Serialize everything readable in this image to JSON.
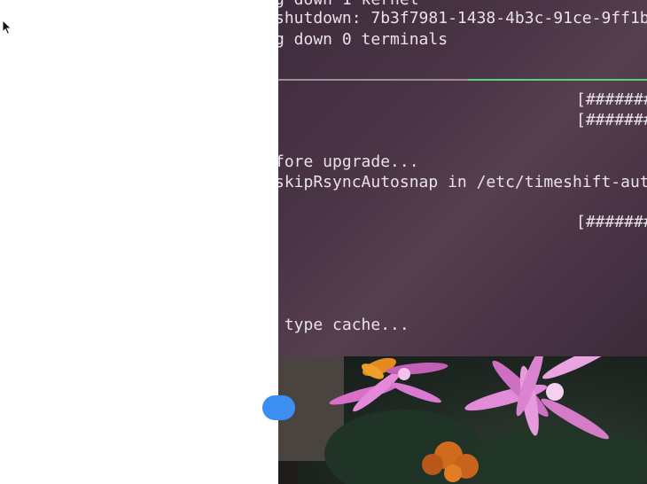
{
  "terminal": {
    "lines": {
      "l1": "g down 1 kernel",
      "l2": "shutdown: 7b3f7981-1438-4b3c-91ce-9ff1b",
      "l3": "g down 0 terminals",
      "p1": "[#######",
      "p2": "[#######",
      "l4": "fore upgrade...",
      "l5": "skipRsyncAutosnap in /etc/timeshift-aut",
      "p3": "[#######",
      "l6": " type cache..."
    },
    "accent_color": "#5bd37d"
  },
  "icons": {
    "cursor": "mouse-pointer-icon",
    "dock_dot": "blue-dot-indicator"
  }
}
